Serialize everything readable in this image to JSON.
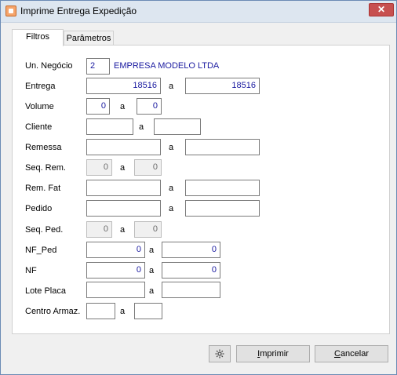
{
  "window": {
    "title": "Imprime Entrega Expedição",
    "close_symbol": "✕"
  },
  "tabs": [
    {
      "label": "Filtros"
    },
    {
      "label": "Parâmetros"
    }
  ],
  "fields": {
    "un_negocio": {
      "label": "Un. Negócio",
      "value": "2",
      "description": "EMPRESA MODELO LTDA"
    },
    "entrega": {
      "label": "Entrega",
      "from": "18516",
      "sep": "a",
      "to": "18516"
    },
    "volume": {
      "label": "Volume",
      "from": "0",
      "sep": "a",
      "to": "0"
    },
    "cliente": {
      "label": "Cliente",
      "from": "",
      "sep": "a",
      "to": ""
    },
    "remessa": {
      "label": "Remessa",
      "from": "",
      "sep": "a",
      "to": ""
    },
    "seq_rem": {
      "label": "Seq. Rem.",
      "from": "0",
      "sep": "a",
      "to": "0"
    },
    "rem_fat": {
      "label": "Rem. Fat",
      "from": "",
      "sep": "a",
      "to": ""
    },
    "pedido": {
      "label": "Pedido",
      "from": "",
      "sep": "a",
      "to": ""
    },
    "seq_ped": {
      "label": "Seq. Ped.",
      "from": "0",
      "sep": "a",
      "to": "0"
    },
    "nf_ped": {
      "label": "NF_Ped",
      "from": "0",
      "sep": "a",
      "to": "0"
    },
    "nf": {
      "label": "NF",
      "from": "0",
      "sep": "a",
      "to": "0"
    },
    "lote_placa": {
      "label": "Lote Placa",
      "from": "",
      "sep": "a",
      "to": ""
    },
    "centro_armaz": {
      "label": "Centro Armaz.",
      "from": "",
      "sep": "a",
      "to": ""
    }
  },
  "buttons": {
    "settings_icon": "gear-icon",
    "imprimir_mnemonic": "I",
    "imprimir_rest": "mprimir",
    "cancelar_mnemonic": "C",
    "cancelar_rest": "ancelar"
  }
}
